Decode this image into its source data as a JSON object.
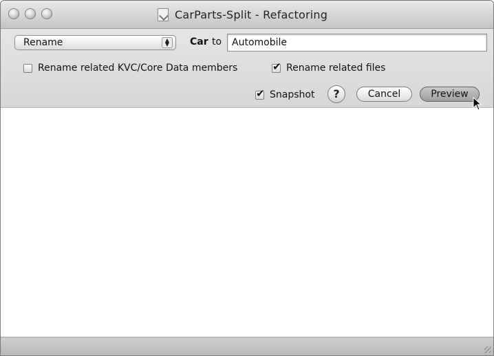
{
  "window": {
    "title": "CarParts-Split - Refactoring"
  },
  "toolbar": {
    "operation_select": "Rename",
    "old_name": "Car",
    "to_label": "to",
    "new_name_value": "Automobile"
  },
  "options": {
    "rename_kvc_label": "Rename related KVC/Core Data members",
    "rename_kvc_checked": false,
    "rename_files_label": "Rename related files",
    "rename_files_checked": true,
    "snapshot_label": "Snapshot",
    "snapshot_checked": true
  },
  "buttons": {
    "help_label": "?",
    "cancel_label": "Cancel",
    "preview_label": "Preview"
  },
  "icons": {
    "window_controls": [
      "close-icon",
      "minimize-icon",
      "zoom-icon"
    ],
    "document": "document-icon",
    "select_arrows": "updown-arrows-icon",
    "cursor": "pointer-cursor-icon",
    "resize": "resize-grip-icon"
  }
}
